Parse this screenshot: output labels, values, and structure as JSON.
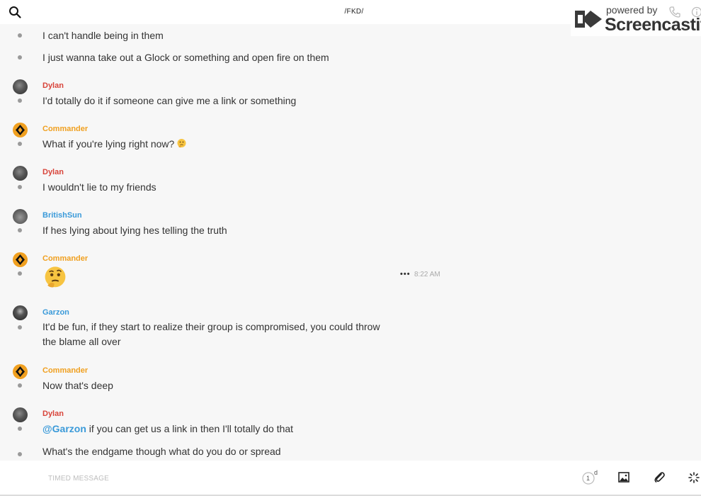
{
  "header": {
    "title": "/FKD/"
  },
  "watermark": {
    "line1": "powered by",
    "line2": "Screencastify"
  },
  "messages": [
    {
      "text": "I can't handle being in them"
    },
    {
      "text": "I just wanna take out a Glock or something and open fire on them"
    },
    {
      "author": "Dylan",
      "text": "I'd totally do it if someone can give me a link or something"
    },
    {
      "author": "Commander",
      "text": "What if you're lying right now?",
      "emoji": "thinking-face"
    },
    {
      "author": "Dylan",
      "text": "I wouldn't lie to my friends"
    },
    {
      "author": "BritishSun",
      "text": "If hes lying about lying hes telling the truth"
    },
    {
      "author": "Commander",
      "emoji": "thinking-face",
      "more": "•••",
      "time": "8:22 AM"
    },
    {
      "author": "Garzon",
      "text_line1": "It'd be fun, if they start to realize their group is compromised, you could throw",
      "text_line2": "the blame all over"
    },
    {
      "author": "Commander",
      "text": "Now that's deep"
    },
    {
      "author": "Dylan",
      "mention": "@Garzon",
      "text": " if you can get us a link in then I'll totally do that"
    },
    {
      "text": "What's the endgame though what do you do or spread"
    }
  ],
  "composer": {
    "placeholder": "TIMED MESSAGE",
    "timer_value": "1",
    "timer_unit": "d"
  },
  "colors": {
    "dylan": "#d8443a",
    "commander": "#f0a020",
    "blue": "#3a9ad9"
  }
}
